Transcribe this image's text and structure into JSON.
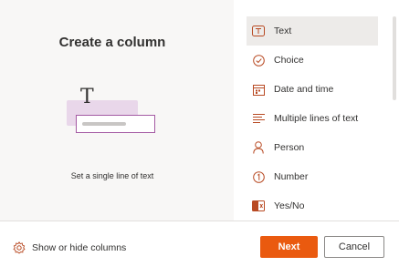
{
  "left_panel": {
    "title": "Create a column",
    "illustration_glyph": "T",
    "caption": "Set a single line of text"
  },
  "column_types": [
    {
      "label": "Text",
      "icon": "text-box-icon",
      "selected": true
    },
    {
      "label": "Choice",
      "icon": "choice-check-icon",
      "selected": false
    },
    {
      "label": "Date and time",
      "icon": "calendar-icon",
      "selected": false
    },
    {
      "label": "Multiple lines of text",
      "icon": "multiline-text-icon",
      "selected": false
    },
    {
      "label": "Person",
      "icon": "person-icon",
      "selected": false
    },
    {
      "label": "Number",
      "icon": "number-icon",
      "selected": false
    },
    {
      "label": "Yes/No",
      "icon": "toggle-icon",
      "selected": false
    }
  ],
  "footer": {
    "show_hide_label": "Show or hide columns",
    "next_label": "Next",
    "cancel_label": "Cancel"
  },
  "colors": {
    "accent": "#ea5a0f",
    "icon": "#b84a23",
    "selected_bg": "#edebe9"
  }
}
